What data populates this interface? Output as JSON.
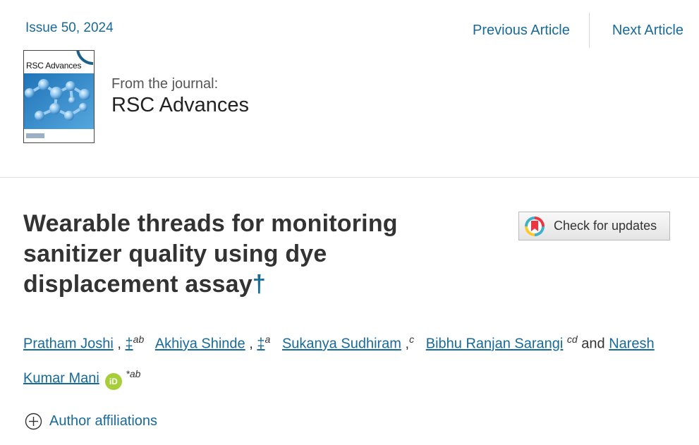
{
  "issue": "Issue 50, 2024",
  "nav": {
    "previous": "Previous Article",
    "next": "Next Article"
  },
  "cover": {
    "title": "RSC Advances"
  },
  "journal": {
    "from_label": "From the journal:",
    "name": "RSC Advances"
  },
  "article": {
    "title": "Wearable threads for monitoring sanitizer quality using dye displacement assay",
    "title_mark": "†"
  },
  "check_updates": {
    "label": "Check for updates",
    "icon": "crossmark-icon"
  },
  "authors": {
    "list": [
      {
        "name": "Pratham Joshi",
        "sep": ",",
        "mark": "‡",
        "sup": "ab"
      },
      {
        "name": "Akhiya Shinde",
        "sep": ",",
        "mark": "‡",
        "sup": "a"
      },
      {
        "name": "Sukanya Sudhiram",
        "sep": ",",
        "sup": "c"
      },
      {
        "name": "Bibhu Ranjan Sarangi",
        "sup": "cd"
      },
      {
        "name": "Naresh Kumar Mani",
        "star": "*",
        "sup": "ab"
      }
    ],
    "and": "and",
    "orcid": "iD",
    "accent_color": "#176a9a",
    "orcid_color": "#a6ce39"
  },
  "affiliations": {
    "label": "Author affiliations",
    "icon": "circle-plus-icon"
  }
}
